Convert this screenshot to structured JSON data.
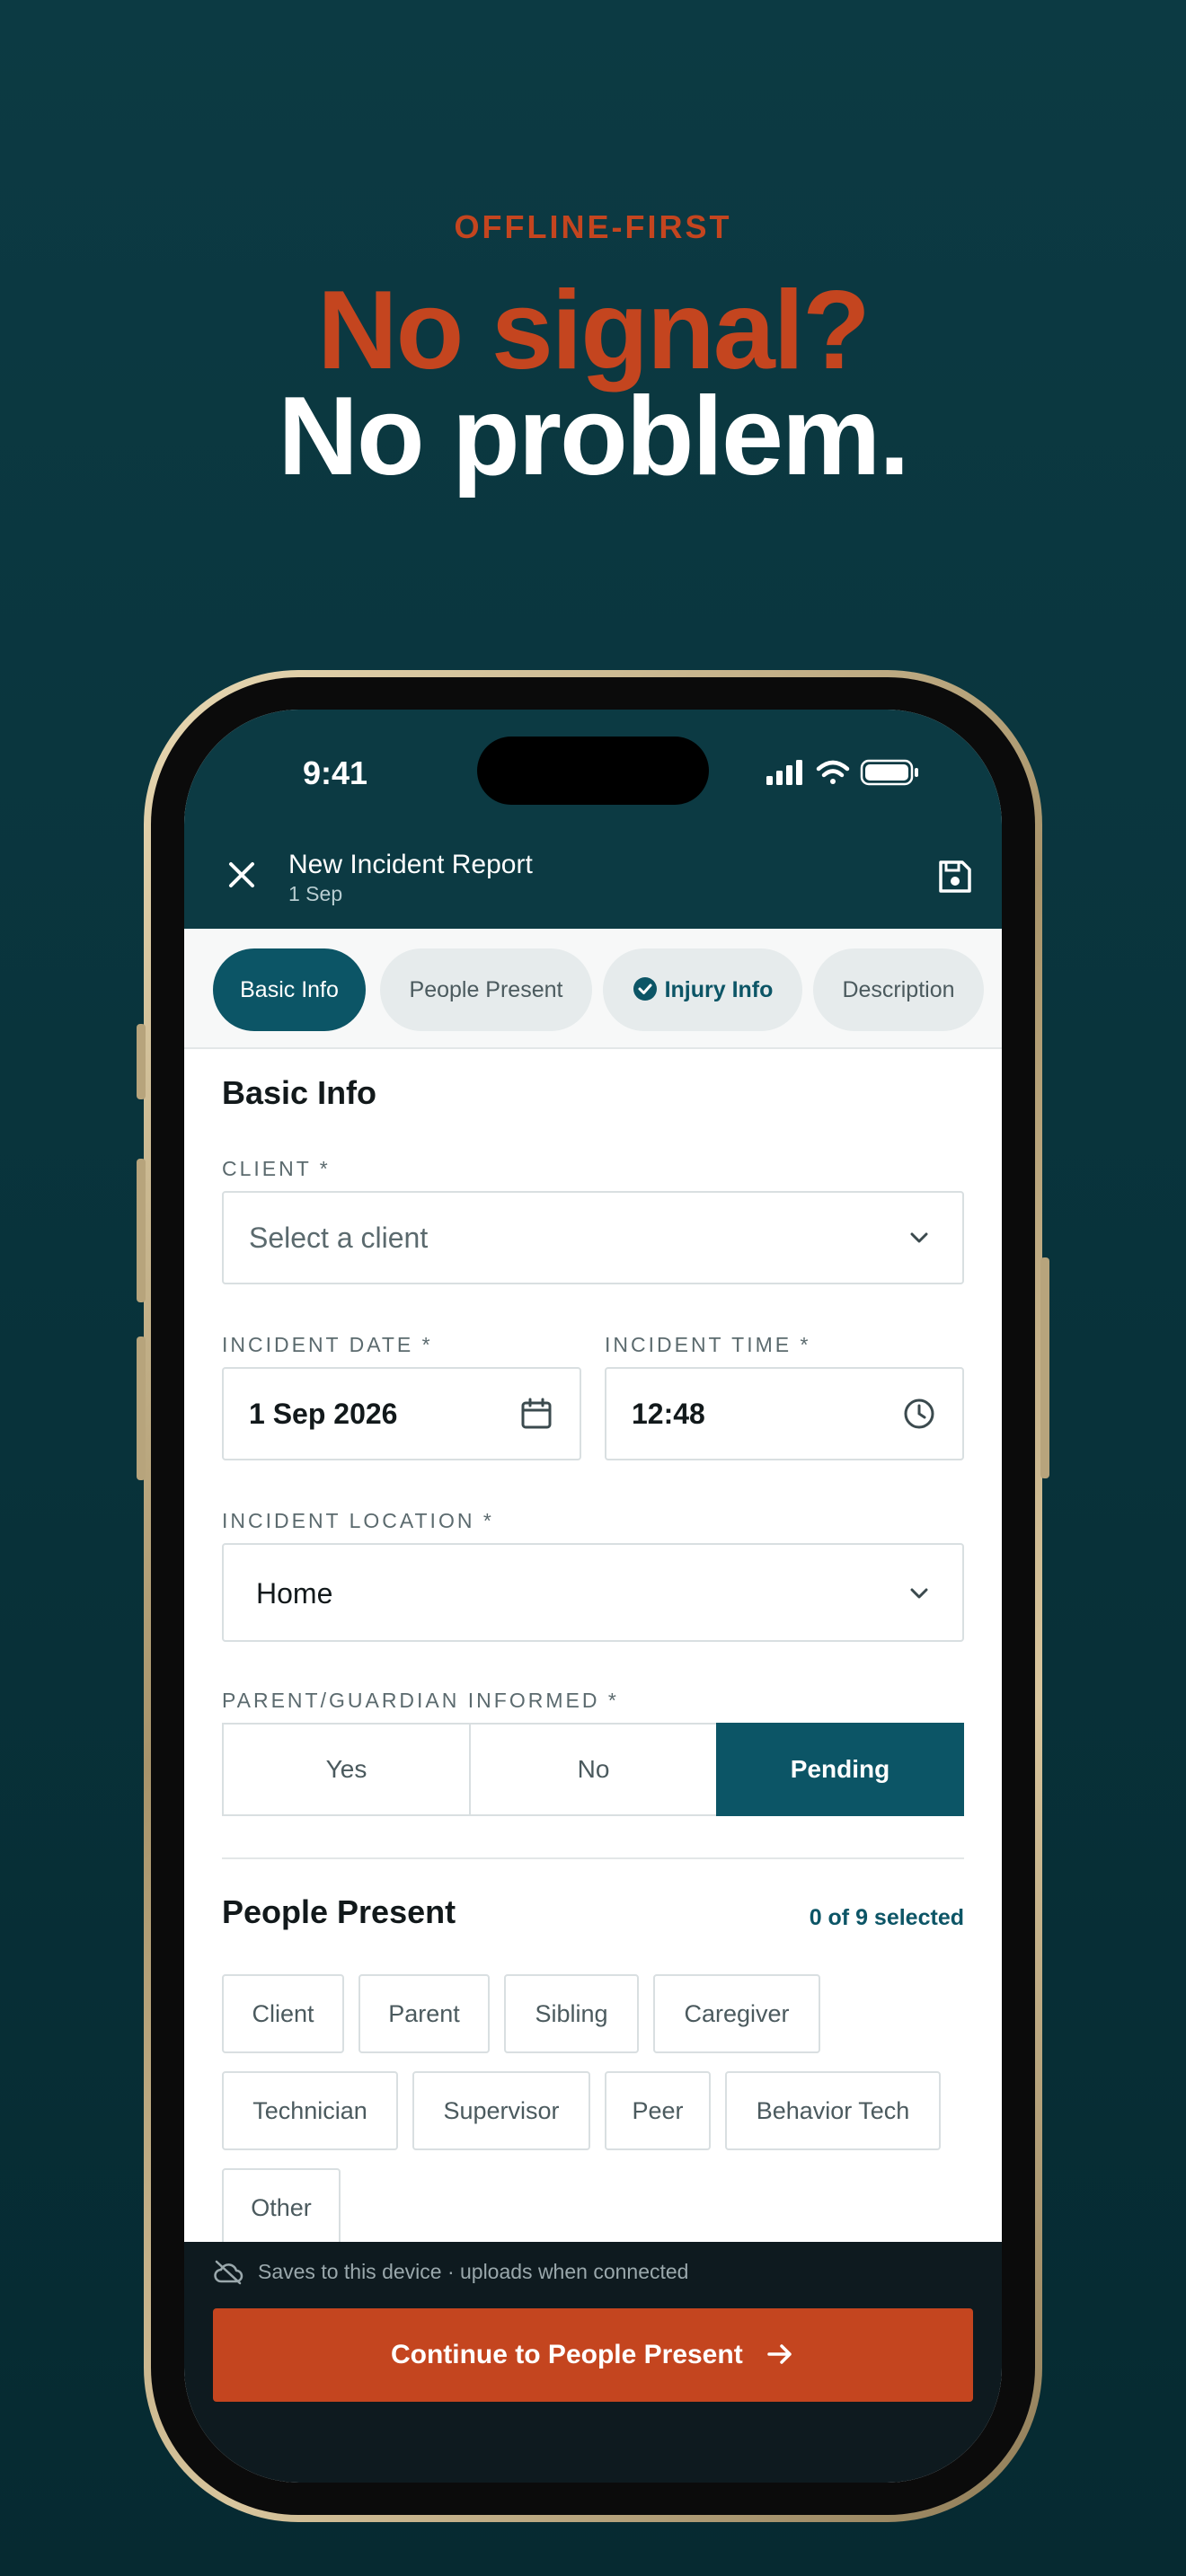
{
  "hero": {
    "eyebrow": "OFFLINE-FIRST",
    "headline_accent": "No signal?",
    "headline_main": "No problem."
  },
  "status_bar": {
    "time": "9:41",
    "icons": [
      "signal-icon",
      "wifi-icon",
      "battery-icon"
    ]
  },
  "nav": {
    "close_icon": "close-icon",
    "title": "New Incident Report",
    "subtitle": "1 Sep",
    "save_icon": "save-icon"
  },
  "tabs": [
    {
      "label": "Basic Info",
      "state": "active"
    },
    {
      "label": "People Present",
      "state": "default"
    },
    {
      "label": "Injury Info",
      "state": "completed"
    },
    {
      "label": "Description",
      "state": "default"
    }
  ],
  "basic_info": {
    "title": "Basic Info",
    "client": {
      "label": "CLIENT *",
      "placeholder": "Select a client"
    },
    "incident_date": {
      "label": "INCIDENT DATE *",
      "value": "1 Sep 2026"
    },
    "incident_time": {
      "label": "INCIDENT TIME *",
      "value": "12:48"
    },
    "incident_location": {
      "label": "INCIDENT LOCATION *",
      "value": "Home"
    },
    "guardian_informed": {
      "label": "PARENT/GUARDIAN INFORMED *",
      "options": [
        "Yes",
        "No",
        "Pending"
      ],
      "selected": "Pending"
    }
  },
  "people_present": {
    "title": "People Present",
    "count": "0 of 9 selected",
    "chips": [
      "Client",
      "Parent",
      "Sibling",
      "Caregiver",
      "Technician",
      "Supervisor",
      "Peer",
      "Behavior Tech",
      "Other"
    ]
  },
  "footer": {
    "offline_note": "Saves to this device · uploads when connected",
    "cta_label": "Continue to People Present"
  },
  "colors": {
    "background": "#0c3a43",
    "accent": "#c4451f",
    "primary": "#0c5566",
    "footer_bg": "#0e1a1f"
  }
}
